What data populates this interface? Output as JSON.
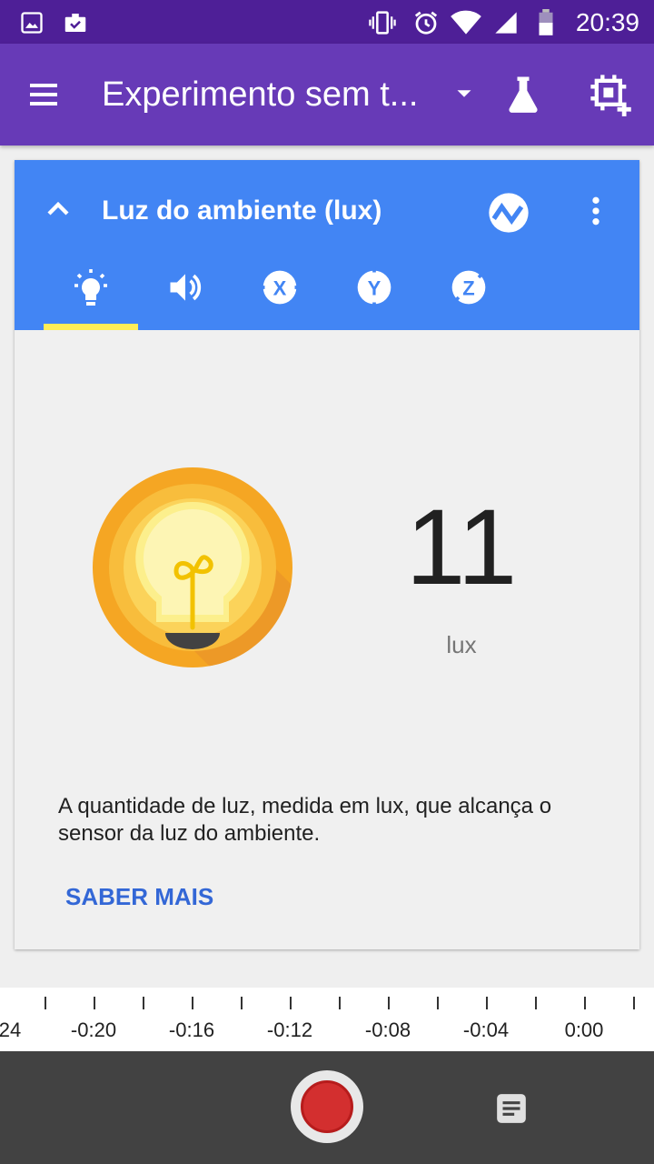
{
  "status_bar": {
    "time": "20:39",
    "icons": [
      "image-icon",
      "briefcase-check-icon",
      "vibrate-icon",
      "alarm-icon",
      "wifi-icon",
      "signal-icon",
      "battery-icon"
    ]
  },
  "app_bar": {
    "title": "Experimento sem t...",
    "icons": [
      "menu-icon",
      "dropdown-icon",
      "flask-icon",
      "add-sensor-icon"
    ]
  },
  "card": {
    "title": "Luz do ambiente (lux)",
    "tabs": [
      {
        "name": "light-sensor",
        "label": ""
      },
      {
        "name": "sound-sensor",
        "label": ""
      },
      {
        "name": "x-axis",
        "label": "X"
      },
      {
        "name": "y-axis",
        "label": "Y"
      },
      {
        "name": "z-axis",
        "label": "Z"
      }
    ],
    "selected_tab": 0,
    "value": "11",
    "unit": "lux",
    "description": "A quantidade de luz, medida em lux, que alcança o sensor da luz do ambiente.",
    "learn_more": "SABER MAIS"
  },
  "timeline": {
    "labels": [
      "24",
      "-0:20",
      "-0:16",
      "-0:12",
      "-0:08",
      "-0:04",
      "0:00"
    ]
  },
  "colors": {
    "status_bar": "#4e1f97",
    "app_bar": "#673ab7",
    "card_header": "#4285f4",
    "tab_indicator": "#ffee58",
    "record": "#d32f2f",
    "bottom_bar": "#424242",
    "link": "#3367d6"
  }
}
